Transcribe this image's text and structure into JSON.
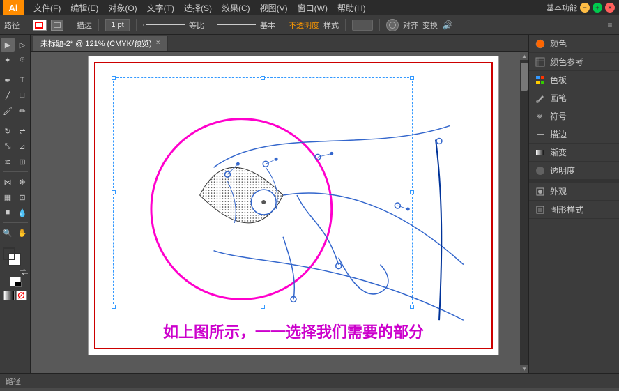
{
  "app": {
    "logo": "Ai",
    "title": "未标题-2* @ 121% (CMYK/预览)",
    "tab_close": "×",
    "workspace_label": "基本功能"
  },
  "menu": {
    "items": [
      "文件(F)",
      "编辑(E)",
      "对象(O)",
      "文字(T)",
      "选择(S)",
      "效果(C)",
      "视图(V)",
      "窗口(W)",
      "帮助(H)"
    ]
  },
  "toolbar": {
    "path_label": "路径",
    "stroke_label": "描边",
    "stroke_width": "1 pt",
    "equal_label": "等比",
    "basic_label": "基本",
    "opacity_label": "不透明度",
    "style_label": "样式",
    "align_label": "对齐",
    "transform_label": "变换"
  },
  "right_panel": {
    "items": [
      {
        "icon": "color",
        "label": "颜色"
      },
      {
        "icon": "color-ref",
        "label": "颜色参考"
      },
      {
        "icon": "swatch",
        "label": "色板"
      },
      {
        "icon": "brush",
        "label": "画笔"
      },
      {
        "icon": "symbol",
        "label": "符号"
      },
      {
        "icon": "stroke",
        "label": "描边"
      },
      {
        "icon": "gradient",
        "label": "渐变"
      },
      {
        "icon": "opacity",
        "label": "透明度"
      },
      {
        "icon": "appearance",
        "label": "外观"
      },
      {
        "icon": "graphic-style",
        "label": "图形样式"
      }
    ]
  },
  "caption": {
    "text": "如上图所示，一一选择我们需要的部分"
  },
  "colors": {
    "magenta": "#ff00cc",
    "blue_path": "#3366cc",
    "dark_blue": "#003399",
    "selection_blue": "#3399ff",
    "caption_color": "#cc00cc",
    "red_border": "#cc0000"
  }
}
